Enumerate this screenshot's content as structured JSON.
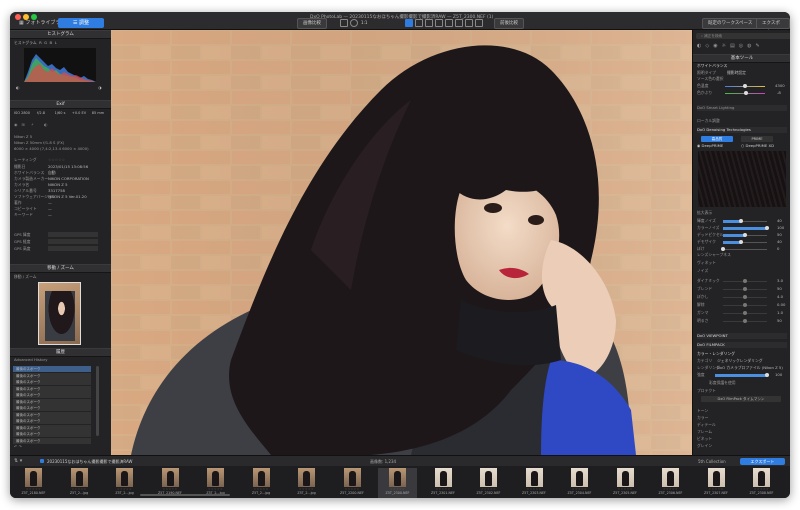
{
  "titlebar": {
    "tab_browser": "フォトライブラリ",
    "tab_customize": "調整",
    "title": "DxO PhotoLab — 20230115なおほちゃん撮影撮影で撮影済RAW — Z5T_2300.NEF (1)",
    "btn_compare": "画像比較",
    "zoom_value": "1:1",
    "btn_split": "前後比較",
    "btn_workspace": "既定のワークスペース",
    "btn_export": "エクスポート"
  },
  "left": {
    "histogram_header": "ヒストグラム",
    "histogram_tabs": [
      "ヒストグラム",
      "R",
      "G",
      "B",
      "L"
    ],
    "exif_header": "Exif",
    "exif_values": [
      "ISO 2800",
      "f/2.8",
      "1/60 s",
      "+0.0 EV",
      "85 mm"
    ],
    "camera": "Nikon Z 5",
    "lens_info": "Nikon Z 50mm f/1.8 S (FX)",
    "dims": "6000 × 4000 (7,4:2,13.4 6000 × 4000)",
    "rating_label": "レーティング",
    "meta_rows": [
      {
        "k": "撮影日",
        "v": "2023/01/15 13:08:56"
      },
      {
        "k": "ホワイトバランス",
        "v": "自動"
      },
      {
        "k": "カメラ製造メーカー",
        "v": "NIKON CORPORATION"
      },
      {
        "k": "カメラ名",
        "v": "NIKON Z 5"
      },
      {
        "k": "シリアル番号",
        "v": "3317758"
      },
      {
        "k": "ソフトウェアバージョン",
        "v": "NIKON Z 5 Ver.01.20"
      },
      {
        "k": "著作",
        "v": "—"
      },
      {
        "k": "コピーライト",
        "v": "—"
      },
      {
        "k": "キーワード",
        "v": "—"
      }
    ],
    "gps_rows": [
      "GPS 緯度",
      "GPS 経度",
      "GPS 高度"
    ],
    "nav_header": "移動 / ズーム",
    "nav_label": "移動 / ズーム",
    "history_header": "履歴",
    "history_title": "Advanced History",
    "history_items": [
      "最後のスポーク",
      "最後のスポーク",
      "最後のスポーク",
      "最後のスポーク",
      "最後のスポーク",
      "最後のスポーク",
      "最後のスポーク",
      "最後のスポーク",
      "最後のスポーク",
      "最後のスポーク",
      "最後のスポーク",
      "最後のスポーク"
    ]
  },
  "right": {
    "search_placeholder": "補正を検索",
    "tools_header": "基本ツール",
    "wb_header": "ホワイトバランス",
    "wb_rows": [
      {
        "k": "照明タイプ",
        "v": "撮影時設定"
      },
      {
        "k": "色温度",
        "v": "4300"
      },
      {
        "k": "色かぶり",
        "v": "-8"
      }
    ],
    "wb_picker": "ソース色の選択",
    "section_smart_lighting": "DxO Smart Lighting",
    "section_local": "ローカル調整",
    "section_denoise": "DxO Denoising Technologies",
    "denoise_tabs": [
      "高品質",
      "PRIME"
    ],
    "deepprime": [
      "DeepPRIME",
      "DeepPRIME XD"
    ],
    "denoise_sub": "拡大表示",
    "denoise_sliders": [
      {
        "k": "輝度ノイズ",
        "v": "40"
      },
      {
        "k": "カラーノイズ",
        "v": "100"
      },
      {
        "k": "デッドピクセル",
        "v": "50"
      },
      {
        "k": "デモザイク",
        "v": "40"
      },
      {
        "k": "ぼけ",
        "v": "0"
      }
    ],
    "section_extra": [
      "レンズシャープネス",
      "ヴィネット",
      "ノイズ"
    ],
    "extra_rows": [
      {
        "k": "ダイナミック",
        "v": "3.0"
      },
      {
        "k": "ブレンド",
        "v": "50"
      },
      {
        "k": "ぼかし",
        "v": "4.0"
      },
      {
        "k": "解除",
        "v": "0.00"
      },
      {
        "k": "ガンマ",
        "v": "1.0"
      },
      {
        "k": "明るさ",
        "v": "50"
      }
    ],
    "section_viewpoint": "DxO VIEWPOINT",
    "section_filmpack": "DxO FILMPACK",
    "color_header": "カラー・レンダリング",
    "color_rows": [
      {
        "k": "カテゴリ",
        "v": "ジェネリックレンダリング"
      },
      {
        "k": "レンダリング",
        "v": "DxO カメラプロファイル (Nikon Z 5)"
      },
      {
        "k": "強度",
        "v": "100"
      }
    ],
    "color_extra": [
      "彩度保護を使用",
      "プロテクト",
      "DxO FilmPack タイムマシン"
    ],
    "bottom_rows": [
      "トーン",
      "カラー",
      "ディテール",
      "フレーム",
      "ビネット",
      "グレイン"
    ]
  },
  "filmbar": {
    "folder": "20230115なおほちゃん撮影撮影で撮影済RAW",
    "center": "画像数: 1,234",
    "filter": "5th Collection",
    "export_btn": "エクスポート"
  },
  "filmstrip": [
    {
      "name": "Z5T_2180.NEF",
      "tone": "dark"
    },
    {
      "name": "Z5T_2...jpg",
      "tone": "dark"
    },
    {
      "name": "Z5T_2...jpg",
      "tone": "dark"
    },
    {
      "name": "Z5T_2190.NEF",
      "tone": "dark"
    },
    {
      "name": "Z5T_2...jpg",
      "tone": "dark"
    },
    {
      "name": "Z5T_2...jpg",
      "tone": "dark"
    },
    {
      "name": "Z5T_2...jpg",
      "tone": "dark"
    },
    {
      "name": "Z5T_2200.NEF",
      "tone": "dark"
    },
    {
      "name": "Z5T_2300.NEF",
      "tone": "selected"
    },
    {
      "name": "Z5T_2301.NEF",
      "tone": "light"
    },
    {
      "name": "Z5T_2302.NEF",
      "tone": "light"
    },
    {
      "name": "Z5T_2303.NEF",
      "tone": "light"
    },
    {
      "name": "Z5T_2304.NEF",
      "tone": "light"
    },
    {
      "name": "Z5T_2305.NEF",
      "tone": "light"
    },
    {
      "name": "Z5T_2306.NEF",
      "tone": "light"
    },
    {
      "name": "Z5T_2307.NEF",
      "tone": "light"
    },
    {
      "name": "Z5T_2308.NEF",
      "tone": "light"
    }
  ],
  "colors": {
    "accent": "#2f7de0",
    "panel": "#232325",
    "bg": "#1c1c1e"
  }
}
